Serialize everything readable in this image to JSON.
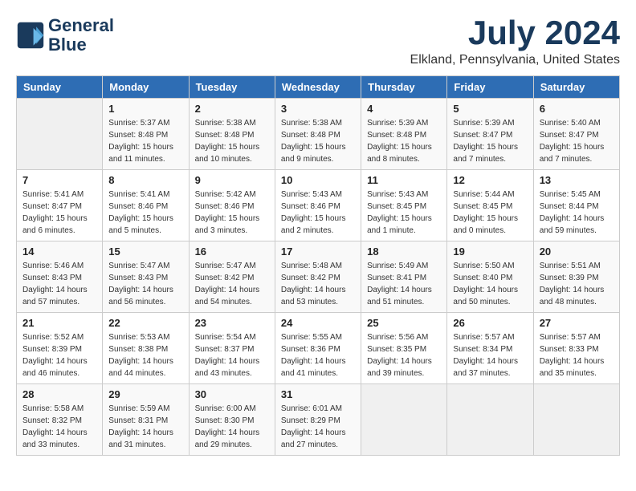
{
  "header": {
    "logo_line1": "General",
    "logo_line2": "Blue",
    "month": "July 2024",
    "location": "Elkland, Pennsylvania, United States"
  },
  "days_of_week": [
    "Sunday",
    "Monday",
    "Tuesday",
    "Wednesday",
    "Thursday",
    "Friday",
    "Saturday"
  ],
  "weeks": [
    [
      {
        "num": "",
        "empty": true
      },
      {
        "num": "1",
        "sunrise": "5:37 AM",
        "sunset": "8:48 PM",
        "daylight": "15 hours and 11 minutes."
      },
      {
        "num": "2",
        "sunrise": "5:38 AM",
        "sunset": "8:48 PM",
        "daylight": "15 hours and 10 minutes."
      },
      {
        "num": "3",
        "sunrise": "5:38 AM",
        "sunset": "8:48 PM",
        "daylight": "15 hours and 9 minutes."
      },
      {
        "num": "4",
        "sunrise": "5:39 AM",
        "sunset": "8:48 PM",
        "daylight": "15 hours and 8 minutes."
      },
      {
        "num": "5",
        "sunrise": "5:39 AM",
        "sunset": "8:47 PM",
        "daylight": "15 hours and 7 minutes."
      },
      {
        "num": "6",
        "sunrise": "5:40 AM",
        "sunset": "8:47 PM",
        "daylight": "15 hours and 7 minutes."
      }
    ],
    [
      {
        "num": "7",
        "sunrise": "5:41 AM",
        "sunset": "8:47 PM",
        "daylight": "15 hours and 6 minutes."
      },
      {
        "num": "8",
        "sunrise": "5:41 AM",
        "sunset": "8:46 PM",
        "daylight": "15 hours and 5 minutes."
      },
      {
        "num": "9",
        "sunrise": "5:42 AM",
        "sunset": "8:46 PM",
        "daylight": "15 hours and 3 minutes."
      },
      {
        "num": "10",
        "sunrise": "5:43 AM",
        "sunset": "8:46 PM",
        "daylight": "15 hours and 2 minutes."
      },
      {
        "num": "11",
        "sunrise": "5:43 AM",
        "sunset": "8:45 PM",
        "daylight": "15 hours and 1 minute."
      },
      {
        "num": "12",
        "sunrise": "5:44 AM",
        "sunset": "8:45 PM",
        "daylight": "15 hours and 0 minutes."
      },
      {
        "num": "13",
        "sunrise": "5:45 AM",
        "sunset": "8:44 PM",
        "daylight": "14 hours and 59 minutes."
      }
    ],
    [
      {
        "num": "14",
        "sunrise": "5:46 AM",
        "sunset": "8:43 PM",
        "daylight": "14 hours and 57 minutes."
      },
      {
        "num": "15",
        "sunrise": "5:47 AM",
        "sunset": "8:43 PM",
        "daylight": "14 hours and 56 minutes."
      },
      {
        "num": "16",
        "sunrise": "5:47 AM",
        "sunset": "8:42 PM",
        "daylight": "14 hours and 54 minutes."
      },
      {
        "num": "17",
        "sunrise": "5:48 AM",
        "sunset": "8:42 PM",
        "daylight": "14 hours and 53 minutes."
      },
      {
        "num": "18",
        "sunrise": "5:49 AM",
        "sunset": "8:41 PM",
        "daylight": "14 hours and 51 minutes."
      },
      {
        "num": "19",
        "sunrise": "5:50 AM",
        "sunset": "8:40 PM",
        "daylight": "14 hours and 50 minutes."
      },
      {
        "num": "20",
        "sunrise": "5:51 AM",
        "sunset": "8:39 PM",
        "daylight": "14 hours and 48 minutes."
      }
    ],
    [
      {
        "num": "21",
        "sunrise": "5:52 AM",
        "sunset": "8:39 PM",
        "daylight": "14 hours and 46 minutes."
      },
      {
        "num": "22",
        "sunrise": "5:53 AM",
        "sunset": "8:38 PM",
        "daylight": "14 hours and 44 minutes."
      },
      {
        "num": "23",
        "sunrise": "5:54 AM",
        "sunset": "8:37 PM",
        "daylight": "14 hours and 43 minutes."
      },
      {
        "num": "24",
        "sunrise": "5:55 AM",
        "sunset": "8:36 PM",
        "daylight": "14 hours and 41 minutes."
      },
      {
        "num": "25",
        "sunrise": "5:56 AM",
        "sunset": "8:35 PM",
        "daylight": "14 hours and 39 minutes."
      },
      {
        "num": "26",
        "sunrise": "5:57 AM",
        "sunset": "8:34 PM",
        "daylight": "14 hours and 37 minutes."
      },
      {
        "num": "27",
        "sunrise": "5:57 AM",
        "sunset": "8:33 PM",
        "daylight": "14 hours and 35 minutes."
      }
    ],
    [
      {
        "num": "28",
        "sunrise": "5:58 AM",
        "sunset": "8:32 PM",
        "daylight": "14 hours and 33 minutes."
      },
      {
        "num": "29",
        "sunrise": "5:59 AM",
        "sunset": "8:31 PM",
        "daylight": "14 hours and 31 minutes."
      },
      {
        "num": "30",
        "sunrise": "6:00 AM",
        "sunset": "8:30 PM",
        "daylight": "14 hours and 29 minutes."
      },
      {
        "num": "31",
        "sunrise": "6:01 AM",
        "sunset": "8:29 PM",
        "daylight": "14 hours and 27 minutes."
      },
      {
        "num": "",
        "empty": true
      },
      {
        "num": "",
        "empty": true
      },
      {
        "num": "",
        "empty": true
      }
    ]
  ]
}
